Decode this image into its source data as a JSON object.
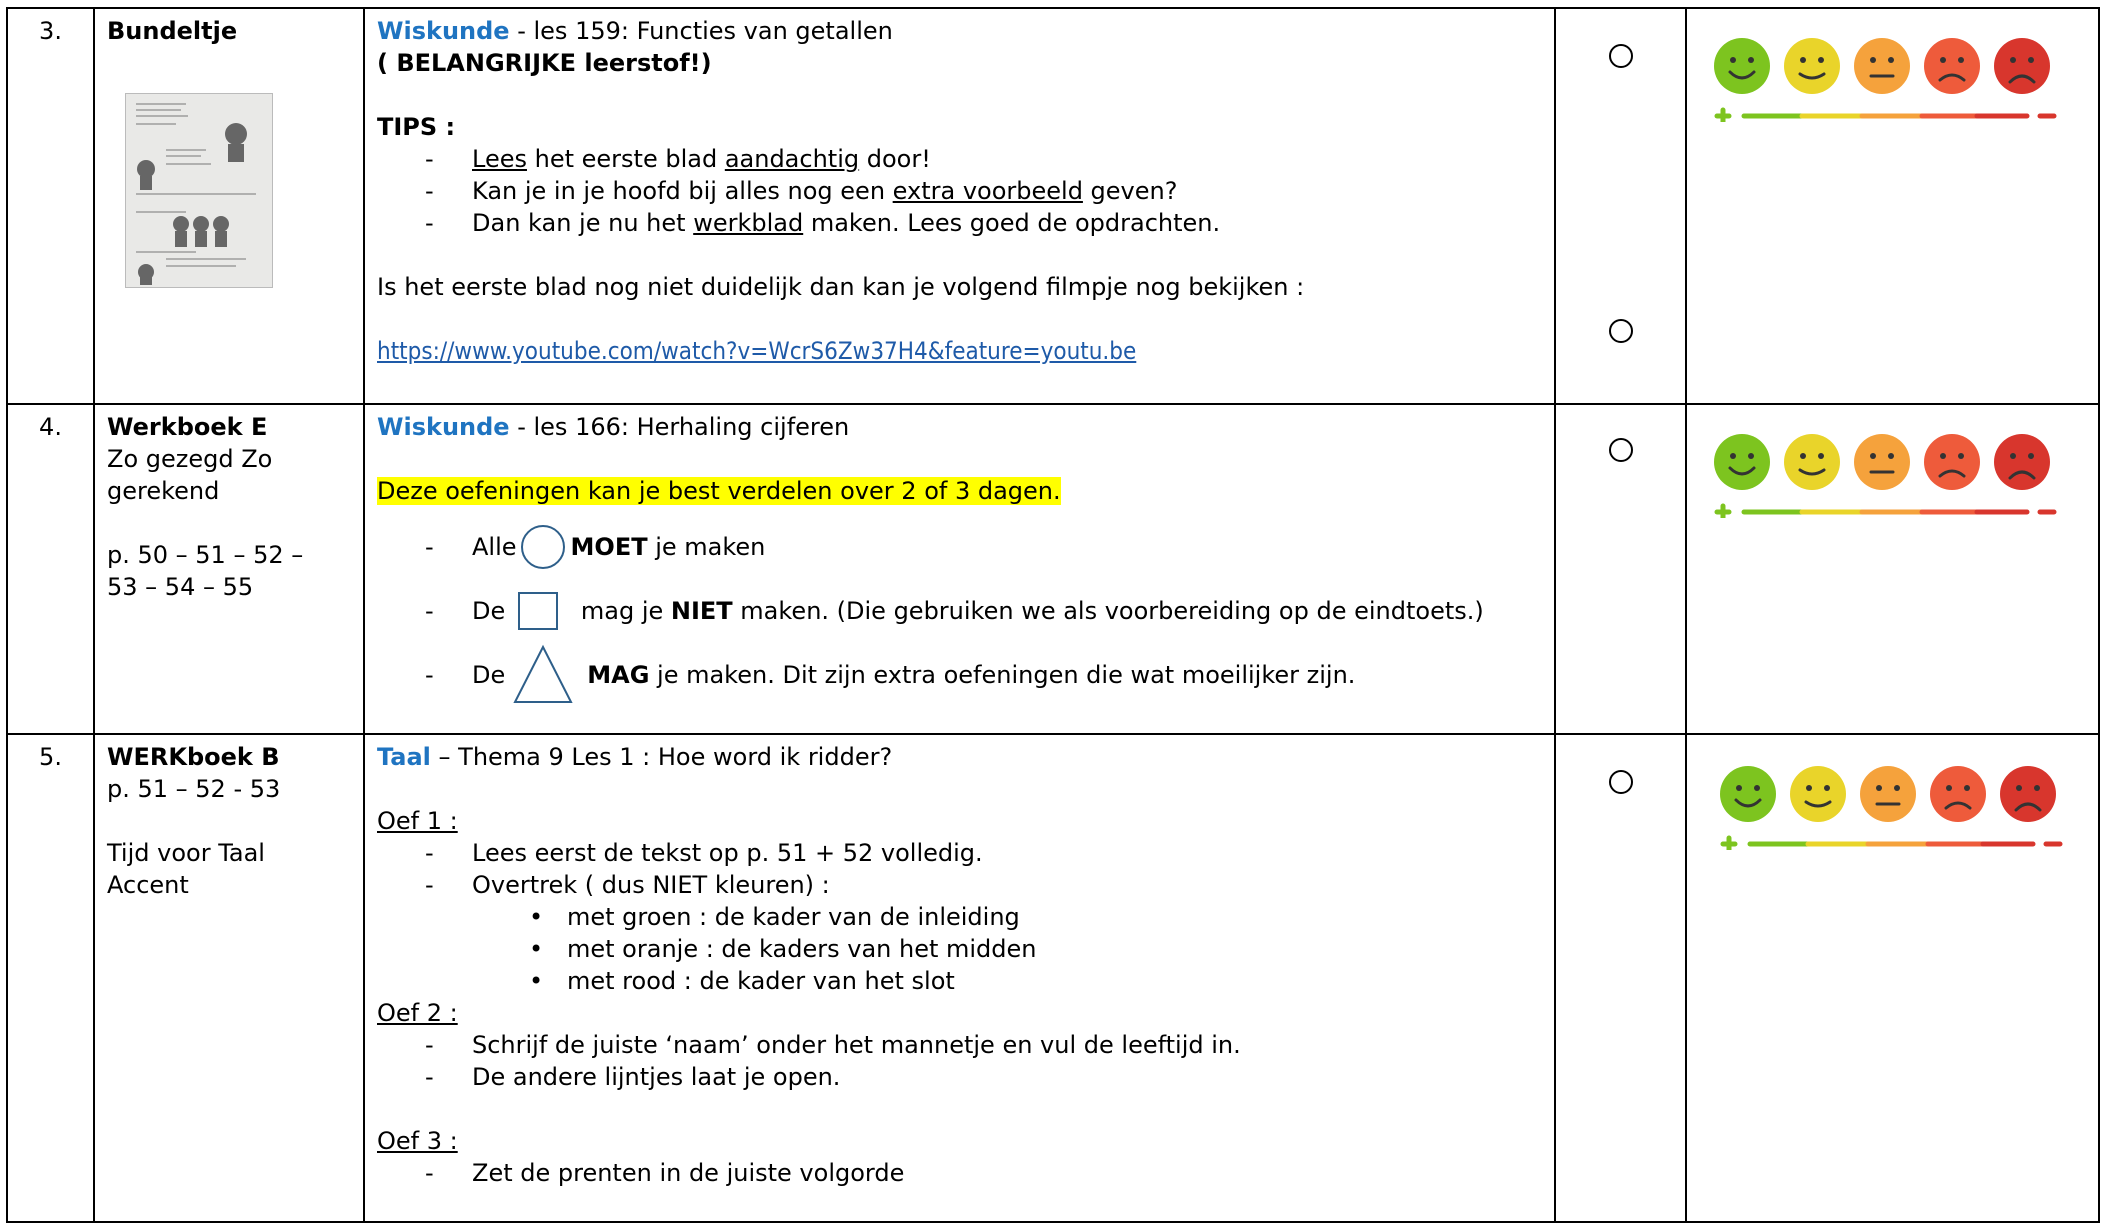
{
  "rows": [
    {
      "number": "3.",
      "source_title": "Bundeltje",
      "subject": "Wiskunde",
      "lesson": " - les 159: Functies van getallen",
      "important": "( BELANGRIJKE leerstof!)",
      "tips_label": "TIPS :",
      "tips": [
        {
          "u1": "Lees",
          "t1": " het eerste blad ",
          "u2": "aandachtig",
          "t2": " door!"
        },
        {
          "t0": "Kan je in je hoofd bij alles nog een ",
          "u1": "extra voorbeeld",
          "t1": " geven?"
        },
        {
          "t0": "Dan kan je nu het ",
          "u1": "werkblad",
          "t1": " maken. Lees goed de opdrachten."
        }
      ],
      "note": "Is het eerste blad nog niet duidelijk dan kan je volgend filmpje nog bekijken :",
      "link": "https://www.youtube.com/watch?v=WcrS6Zw37H4&feature=youtu.be"
    },
    {
      "number": "4.",
      "source_title": "Werkboek  E",
      "source_lines": [
        "Zo gezegd Zo",
        "gerekend",
        "",
        "p. 50 – 51 – 52 –",
        "53 – 54 – 55"
      ],
      "subject": "Wiskunde",
      "lesson": " - les 166: Herhaling cijferen",
      "highlight": "Deze oefeningen kan je best verdelen over 2 of 3 dagen.",
      "shape_items": [
        {
          "pre": "Alle",
          "bold": "MOET",
          "post": " je maken",
          "shape": "circle"
        },
        {
          "pre": "De",
          "mid": " mag je ",
          "bold": "NIET",
          "post": " maken. (Die gebruiken we als voorbereiding op de eindtoets.)",
          "shape": "square"
        },
        {
          "pre": "De",
          "bold": "MAG",
          "post": " je maken. Dit zijn extra oefeningen die wat moeilijker zijn.",
          "shape": "triangle"
        }
      ]
    },
    {
      "number": "5.",
      "source_title": "WERKboek B",
      "source_lines": [
        "p. 51 – 52 - 53",
        "",
        "Tijd voor Taal",
        "Accent"
      ],
      "subject": "Taal",
      "lesson": " – Thema 9 Les 1 : Hoe word ik ridder?",
      "oef1_label": "Oef 1 :",
      "oef1_items": [
        "Lees eerst de tekst op p. 51 + 52 volledig.",
        "Overtrek ( dus NIET kleuren) :"
      ],
      "oef1_bullets": [
        "met groen : de kader van de inleiding",
        "met oranje : de kaders van het midden",
        "met rood : de kader van het slot"
      ],
      "oef2_label": "Oef 2 :",
      "oef2_items": [
        "Schrijf de juiste ‘naam’ onder het mannetje en vul de leeftijd in.",
        "De andere lijntjes laat je open."
      ],
      "oef3_label": "Oef 3 :",
      "oef3_items": [
        "Zet de prenten in de juiste volgorde"
      ]
    }
  ],
  "colors": {
    "subject_blue": "#1f74c1",
    "link_blue": "#1e5aa8",
    "highlight": "#ffff00",
    "smiley_green": "#7dc41f",
    "smiley_yellow": "#e9d42a",
    "smiley_orange": "#f5a23c",
    "smiley_redorange": "#ee5b3b",
    "smiley_red": "#d8362d"
  },
  "icons": [
    "empty-checkbox-circle-icon",
    "smiley-rating-scale-icon",
    "worksheet-thumbnail-image"
  ]
}
